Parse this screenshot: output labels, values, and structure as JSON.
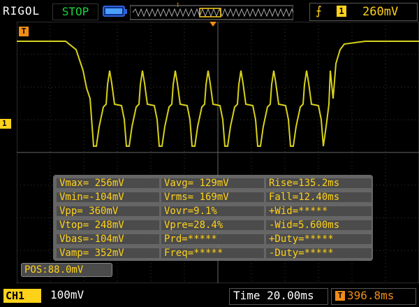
{
  "header": {
    "brand": "RIGOL",
    "run_state": "STOP",
    "trigger_channel": "1",
    "trigger_level": "260mV",
    "trigger_marker": "T"
  },
  "screen": {
    "time_marker": "T",
    "channel_marker": "1"
  },
  "measurements": [
    [
      "Vmax= 256mV",
      "Vavg= 129mV",
      "Rise=135.2ms"
    ],
    [
      "Vmin=-104mV",
      "Vrms= 169mV",
      "Fall=12.40ms"
    ],
    [
      "Vpp= 360mV",
      "Vovr=9.1%",
      "+Wid=*****"
    ],
    [
      "Vtop= 248mV",
      "Vpre=28.4%",
      "-Wid=5.600ms"
    ],
    [
      "Vbas=-104mV",
      "Prd=*****",
      "+Duty=*****"
    ],
    [
      "Vamp= 352mV",
      "Freq=*****",
      "-Duty=*****"
    ]
  ],
  "position": "POS:88.0mV",
  "footer": {
    "channel": "CH1",
    "channel_scale": "100mV",
    "timebase": "Time 20.00ms",
    "trigger_offset_marker": "T",
    "trigger_offset": "396.8ms"
  },
  "colors": {
    "trace": "#d8d21a",
    "accent_yellow": "#ffd21a",
    "run_state": "#19d63a",
    "trigger_orange": "#f08c19"
  }
}
